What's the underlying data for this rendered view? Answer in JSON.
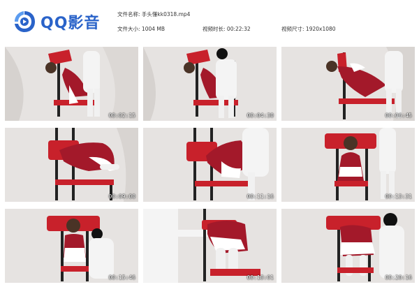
{
  "app": {
    "name": "QQ影音",
    "brand_color": "#2a63c9"
  },
  "info": {
    "filename_label": "文件名称:",
    "filename_value": "手头懂kk0318.mp4",
    "filesize_label": "文件大小:",
    "filesize_value": "1004 MB",
    "duration_label": "视频时长:",
    "duration_value": "00:22:32",
    "resolution_label": "视频尺寸:",
    "resolution_value": "1920x1080"
  },
  "thumbnails": [
    {
      "time": "00:02:15"
    },
    {
      "time": "00:04:30"
    },
    {
      "time": "00:06:45"
    },
    {
      "time": "00:09:00"
    },
    {
      "time": "00:11:16"
    },
    {
      "time": "00:13:31"
    },
    {
      "time": "00:15:46"
    },
    {
      "time": "00:18:01"
    },
    {
      "time": "00:20:16"
    }
  ],
  "colors": {
    "chair_red": "#c8212b",
    "dress_red": "#a3192a",
    "backdrop": "#e6e3e1"
  }
}
